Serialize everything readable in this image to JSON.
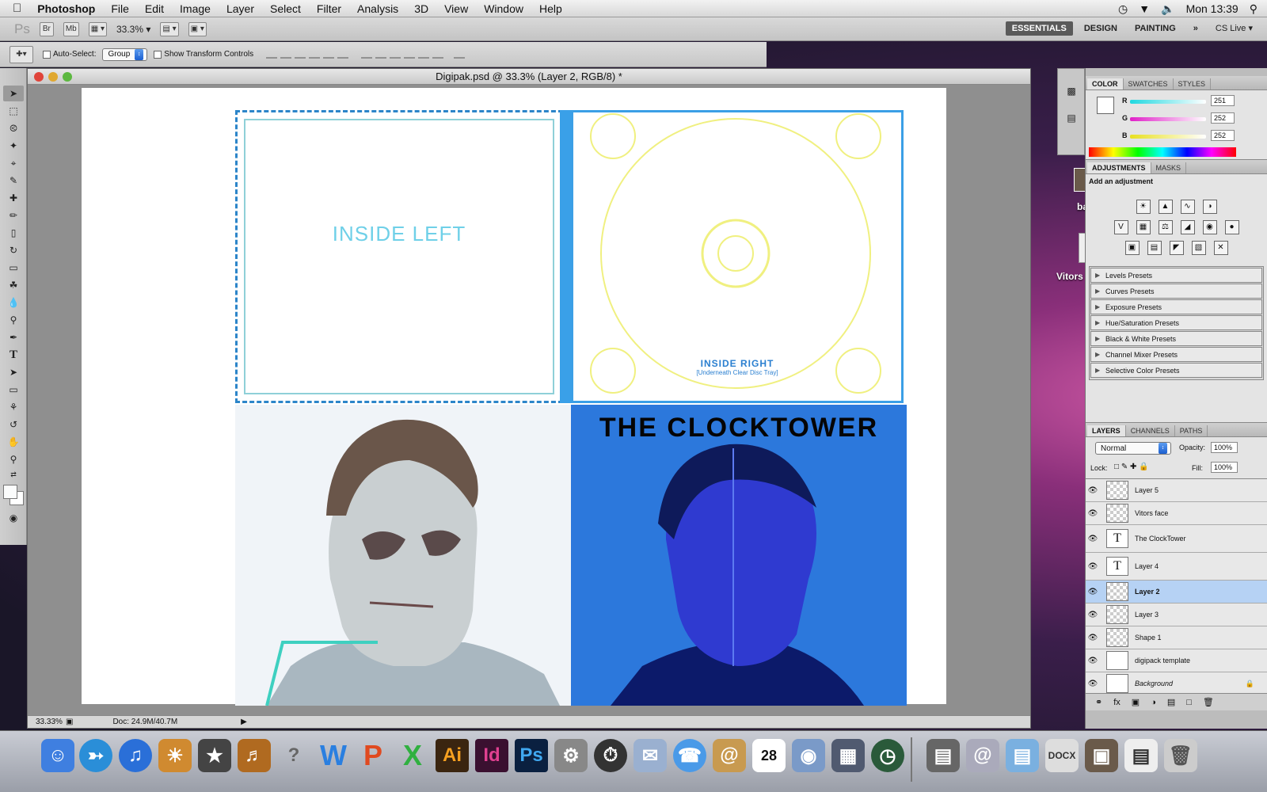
{
  "menubar": {
    "app_name": "Photoshop",
    "items": [
      "File",
      "Edit",
      "Image",
      "Layer",
      "Select",
      "Filter",
      "Analysis",
      "3D",
      "View",
      "Window",
      "Help"
    ],
    "clock": "Mon 13:39"
  },
  "appbar": {
    "logo": "Ps",
    "bridge": "Br",
    "minibridge": "Mb",
    "zoom": "33.3%",
    "workspaces": [
      "ESSENTIALS",
      "DESIGN",
      "PAINTING"
    ],
    "cslive": "CS Live"
  },
  "options": {
    "auto_select_label": "Auto-Select:",
    "auto_select_value": "Group",
    "transform_label": "Show Transform Controls"
  },
  "document": {
    "title": "Digipak.psd @ 33.3% (Layer 2, RGB/8) *",
    "inside_left": "INSIDE LEFT",
    "inside_right": "INSIDE RIGHT",
    "inside_right_sub": "[Underneath Clear Disc Tray]",
    "cover_title": "THE CLOCKTOWER",
    "status_zoom": "33.33%",
    "status_doc": "Doc: 24.9M/40.7M"
  },
  "color_panel": {
    "tabs": [
      "COLOR",
      "SWATCHES",
      "STYLES"
    ],
    "channels": [
      {
        "label": "R",
        "value": "251",
        "color": "#20d8e0"
      },
      {
        "label": "G",
        "value": "252",
        "color": "#e020c8"
      },
      {
        "label": "B",
        "value": "252",
        "color": "#e8e020"
      }
    ]
  },
  "adjust_panel": {
    "tabs": [
      "ADJUSTMENTS",
      "MASKS"
    ],
    "heading": "Add an adjustment",
    "presets": [
      "Levels Presets",
      "Curves Presets",
      "Exposure Presets",
      "Hue/Saturation Presets",
      "Black & White Presets",
      "Channel Mixer Presets",
      "Selective Color Presets"
    ]
  },
  "layers_panel": {
    "tabs": [
      "LAYERS",
      "CHANNELS",
      "PATHS"
    ],
    "blend_mode": "Normal",
    "opacity_label": "Opacity:",
    "opacity": "100%",
    "lock_label": "Lock:",
    "fill_label": "Fill:",
    "fill": "100%",
    "layers": [
      {
        "name": "Layer 5",
        "type": "pixel"
      },
      {
        "name": "Vitors face",
        "type": "pixel"
      },
      {
        "name": "The ClockTower",
        "type": "text"
      },
      {
        "name": "Layer 4",
        "type": "text"
      },
      {
        "name": "Layer 2",
        "type": "pixel",
        "selected": true
      },
      {
        "name": "Layer 3",
        "type": "pixel"
      },
      {
        "name": "Shape 1",
        "type": "pixel"
      },
      {
        "name": "digipack template",
        "type": "pixel"
      },
      {
        "name": "Background",
        "type": "background",
        "locked": true
      }
    ]
  },
  "desktop": {
    "icons": [
      "band",
      "Vitors face"
    ]
  },
  "dock": {
    "apps": [
      "Finder",
      "Safari",
      "iTunes",
      "iPhoto",
      "iMovie",
      "GarageBand",
      "Help",
      "Word",
      "PowerPoint",
      "Excel",
      "Illustrator",
      "InDesign",
      "Photoshop",
      "System Preferences",
      "Dashboard",
      "Mail",
      "iChat",
      "Address Book",
      "iCal",
      "Photo Booth",
      "Spaces",
      "Time Machine"
    ],
    "ical_date": "28"
  }
}
